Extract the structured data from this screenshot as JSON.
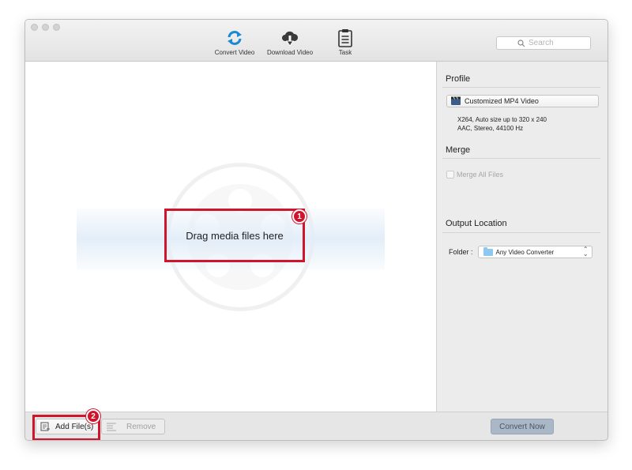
{
  "toolbar": {
    "convert_label": "Convert Video",
    "download_label": "Download Video",
    "task_label": "Task",
    "search_placeholder": "Search"
  },
  "drop_area": {
    "drag_text": "Drag media files here",
    "badge_1": "1"
  },
  "side": {
    "profile_title": "Profile",
    "profile_value": "Customized MP4 Video",
    "profile_desc_1": "X264, Auto size up to 320 x 240",
    "profile_desc_2": "AAC, Stereo, 44100 Hz",
    "merge_title": "Merge",
    "merge_label": "Merge All Files",
    "output_title": "Output Location",
    "folder_label": "Folder :",
    "folder_value": "Any Video Converter"
  },
  "bottom": {
    "add_label": "Add File(s)",
    "remove_label": "Remove",
    "convert_now_label": "Convert Now",
    "badge_2": "2"
  },
  "colors": {
    "highlight": "#d0142c",
    "accent_blue": "#1a8ad4",
    "convert_button": "#a9b7c6"
  }
}
